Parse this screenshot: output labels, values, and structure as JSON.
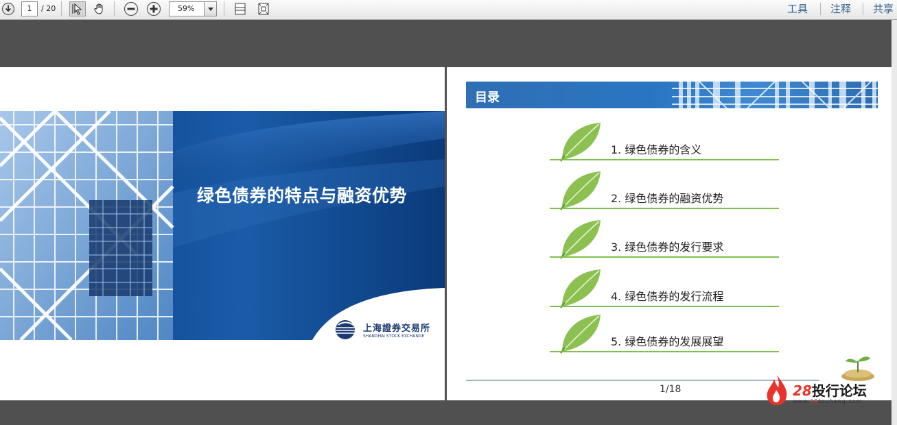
{
  "toolbar": {
    "page_current": "1",
    "page_total": "/ 20",
    "zoom": "59%",
    "tools_label": "工具",
    "comment_label": "注释",
    "share_label": "共享"
  },
  "slide1": {
    "title": "绿色债券的特点与融资优势",
    "logo_cn": "上海證券交易所",
    "logo_en": "SHANGHAI STOCK EXCHANGE"
  },
  "slide2": {
    "header": "目录",
    "items": [
      {
        "label": "1. 绿色债券的含义"
      },
      {
        "label": "2. 绿色债券的融资优势"
      },
      {
        "label": "3. 绿色债券的发行要求"
      },
      {
        "label": "4. 绿色债券的发行流程"
      },
      {
        "label": "5. 绿色债券的发展展望"
      }
    ],
    "page_number": "1/18"
  },
  "watermark": {
    "number": "28",
    "name": "投行论坛",
    "url_prefix": "www.",
    "url_highlight": "28",
    "url_suffix": "touhang.com"
  },
  "colors": {
    "app_bg": "#505050",
    "banner_blue": "#0b3f86",
    "accent_green": "#7fbf4d",
    "link_blue": "#34628f",
    "brand_red": "#e8332a"
  },
  "icons": [
    "download-icon",
    "select-tool-icon",
    "hand-tool-icon",
    "zoom-out-icon",
    "zoom-in-icon",
    "chevron-down-icon",
    "fit-width-icon",
    "fit-page-icon",
    "leaf-icon",
    "flame-icon",
    "coins-sprout-icon"
  ]
}
